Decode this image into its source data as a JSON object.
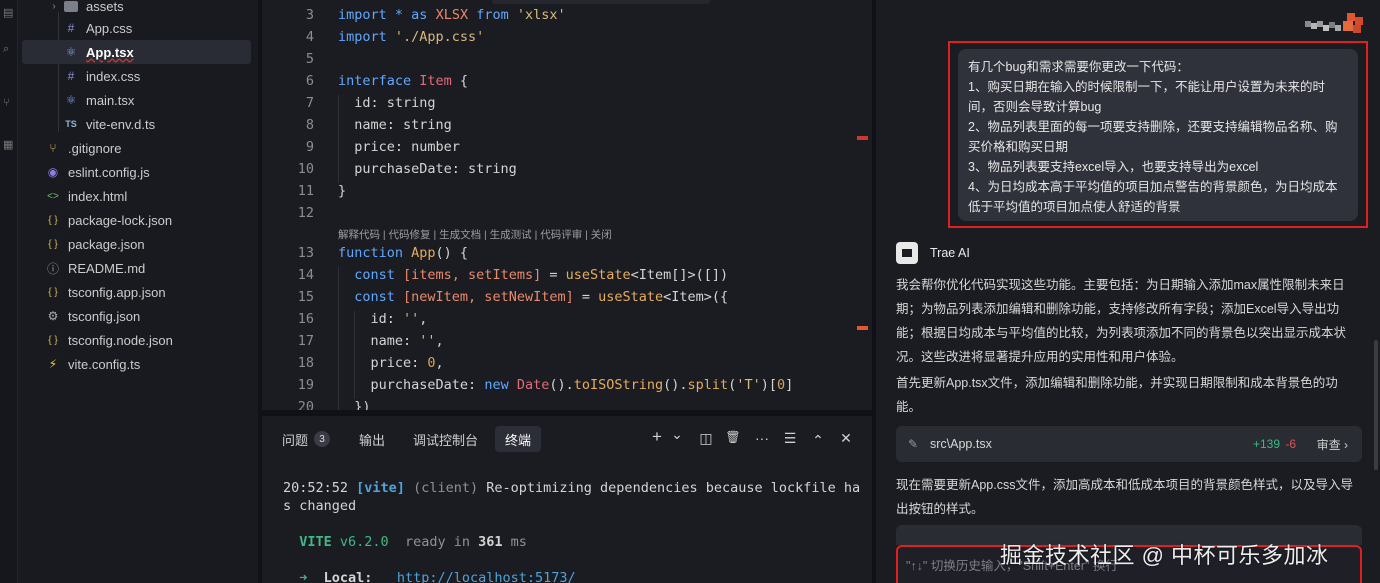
{
  "explorer": {
    "items": [
      {
        "label": "assets",
        "icon": "folder-icon",
        "kind": "folder"
      },
      {
        "label": "App.css",
        "icon": "hash-icon"
      },
      {
        "label": "App.tsx",
        "icon": "react-icon",
        "active": true
      },
      {
        "label": "index.css",
        "icon": "hash-icon"
      },
      {
        "label": "main.tsx",
        "icon": "react-icon"
      },
      {
        "label": "vite-env.d.ts",
        "icon": "ts-icon"
      },
      {
        "label": ".gitignore",
        "icon": "git-icon"
      },
      {
        "label": "eslint.config.js",
        "icon": "eslint-icon"
      },
      {
        "label": "index.html",
        "icon": "html-icon"
      },
      {
        "label": "package-lock.json",
        "icon": "json-icon"
      },
      {
        "label": "package.json",
        "icon": "json-icon"
      },
      {
        "label": "README.md",
        "icon": "info-icon"
      },
      {
        "label": "tsconfig.app.json",
        "icon": "json-icon"
      },
      {
        "label": "tsconfig.json",
        "icon": "gear-icon"
      },
      {
        "label": "tsconfig.node.json",
        "icon": "json-icon"
      },
      {
        "label": "vite.config.ts",
        "icon": "vite-icon"
      }
    ],
    "glyphs": {
      "hash": "#",
      "ts": "TS",
      "json": "{ }",
      "html": "<>",
      "react": "⚛",
      "git": "⑂",
      "info": "ⓘ",
      "gear": "⚙",
      "eslint": "◉",
      "vite": "⚡",
      "chevron": "›"
    }
  },
  "editor": {
    "line_numbers": [
      "3",
      "4",
      "5",
      "6",
      "7",
      "8",
      "9",
      "10",
      "11",
      "12",
      "13",
      "14",
      "15",
      "16",
      "17",
      "18",
      "19",
      "20"
    ],
    "codelens": "解释代码 | 代码修复 | 生成文档 | 生成测试 | 代码评审 | 关闭",
    "code": {
      "l3_import": "import",
      "l3_star": " * as ",
      "l3_xlsx": "XLSX",
      "l3_from": " from ",
      "l3_mod": "'xlsx'",
      "l4_import": "import",
      "l4_mod": " './App.css'",
      "l6_interface": "interface",
      "l6_name": " Item",
      "l6_brace": " {",
      "l7": "  id: string",
      "l8": "  name: string",
      "l9": "  price: number",
      "l10": "  purchaseDate: string",
      "l11": "}",
      "l13_function": "function",
      "l13_name": " App",
      "l13_rest": "() {",
      "l14_const": "  const",
      "l14_a": " [items, setItems]",
      "l14_eq": " = ",
      "l14_fn": "useState",
      "l14_rest": "<Item[]>([])",
      "l15_const": "  const",
      "l15_a": " [newItem, setNewItem]",
      "l15_eq": " = ",
      "l15_fn": "useState",
      "l15_rest": "<Item>({",
      "l16_key": "    id: ",
      "l16_val": "''",
      "l16_end": ",",
      "l17_key": "    name: ",
      "l17_val": "''",
      "l17_end": ",",
      "l18_key": "    price: ",
      "l18_val": "0",
      "l18_end": ",",
      "l19_key": "    purchaseDate: ",
      "l19_new": "new",
      "l19_date": " Date",
      "l19_p1": "().",
      "l19_iso": "toISOString",
      "l19_p2": "().",
      "l19_split": "split",
      "l19_p3": "(",
      "l19_t": "'T'",
      "l19_p4": ")[",
      "l19_zero": "0",
      "l19_p5": "]",
      "l20": "  })"
    }
  },
  "panel": {
    "tabs": [
      {
        "label": "问题",
        "badge": "3"
      },
      {
        "label": "输出"
      },
      {
        "label": "调试控制台"
      },
      {
        "label": "终端",
        "active": true
      }
    ],
    "tools": {
      "add": "+",
      "dropdown": "⌄",
      "split": "◫",
      "trash": "🗑",
      "more": "···",
      "settings": "☰",
      "maximize": "⌃",
      "close": "✕"
    },
    "terminal": {
      "time": "20:52:52",
      "tag": "[vite]",
      "client": "(client)",
      "msg1": "Re-optimizing dependencies because lockfile ha",
      "msg2": "s changed",
      "vite": "VITE",
      "version": "v6.2.0",
      "ready": "ready in",
      "ms_num": "361",
      "ms": "ms",
      "arrow": "➜",
      "local_label": "Local:",
      "local_url": "http://localhost:5173/"
    }
  },
  "chat": {
    "user_message": [
      "有几个bug和需求需要你更改一下代码：",
      "1、购买日期在输入的时候限制一下，不能让用户设置为未来的时间，否则会导致计算bug",
      "2、物品列表里面的每一项要支持删除，还要支持编辑物品名称、购买价格和购买日期",
      "3、物品列表要支持excel导入，也要支持导出为excel",
      "4、为日均成本高于平均值的项目加点警告的背景颜色，为日均成本低于平均值的项目加点使人舒适的背景"
    ],
    "ai_name": "Trae AI",
    "ai_p1": "我会帮你优化代码实现这些功能。主要包括：为日期输入添加max属性限制未来日期；为物品列表添加编辑和删除功能，支持修改所有字段；添加Excel导入导出功能；根据日均成本与平均值的比较，为列表项添加不同的背景色以突出显示成本状况。这些改进将显著提升应用的实用性和用户体验。",
    "ai_p2": "首先更新App.tsx文件，添加编辑和删除功能，并实现日期限制和成本背景色的功能。",
    "file_card": {
      "path": "src\\App.tsx",
      "added": "+139",
      "removed": "-6",
      "review": "审查 ›"
    },
    "ai_p3": "现在需要更新App.css文件，添加高成本和低成本项目的背景颜色样式，以及导入导出按钮的样式。",
    "input_placeholder": "\"↑↓\" 切换历史输入，\"Shift+Enter\" 换行"
  },
  "watermark": "掘金技术社区 @ 中杯可乐多加冰",
  "colors": {
    "accent_red": "#e0201f",
    "added_green": "#3fb884",
    "removed_red": "#e05252",
    "keyword_blue": "#5ea8ff"
  }
}
